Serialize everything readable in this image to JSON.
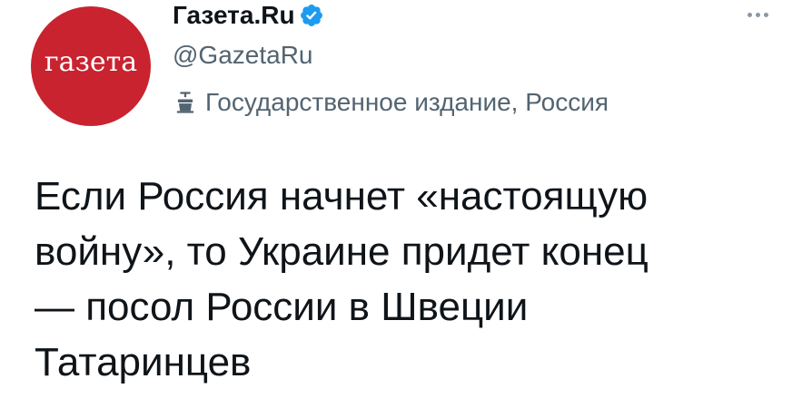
{
  "account": {
    "display_name": "Газета.Ru",
    "handle": "@GazetaRu",
    "label": "Государственное издание, Россия",
    "avatar_text": "газета",
    "verified": true
  },
  "tweet": {
    "lines": [
      "Если Россия начнет «настоящую",
      "войну», то Украине придет конец",
      "— посол России в Швеции",
      "Татаринцев"
    ]
  },
  "icons": {
    "verified": "verified-badge-icon",
    "label": "government-podium-icon",
    "more": "more-options-icon"
  },
  "colors": {
    "avatar_bg": "#c8232f",
    "verified": "#1d9bf0",
    "secondary_text": "#536471",
    "primary_text": "#0f1419"
  }
}
